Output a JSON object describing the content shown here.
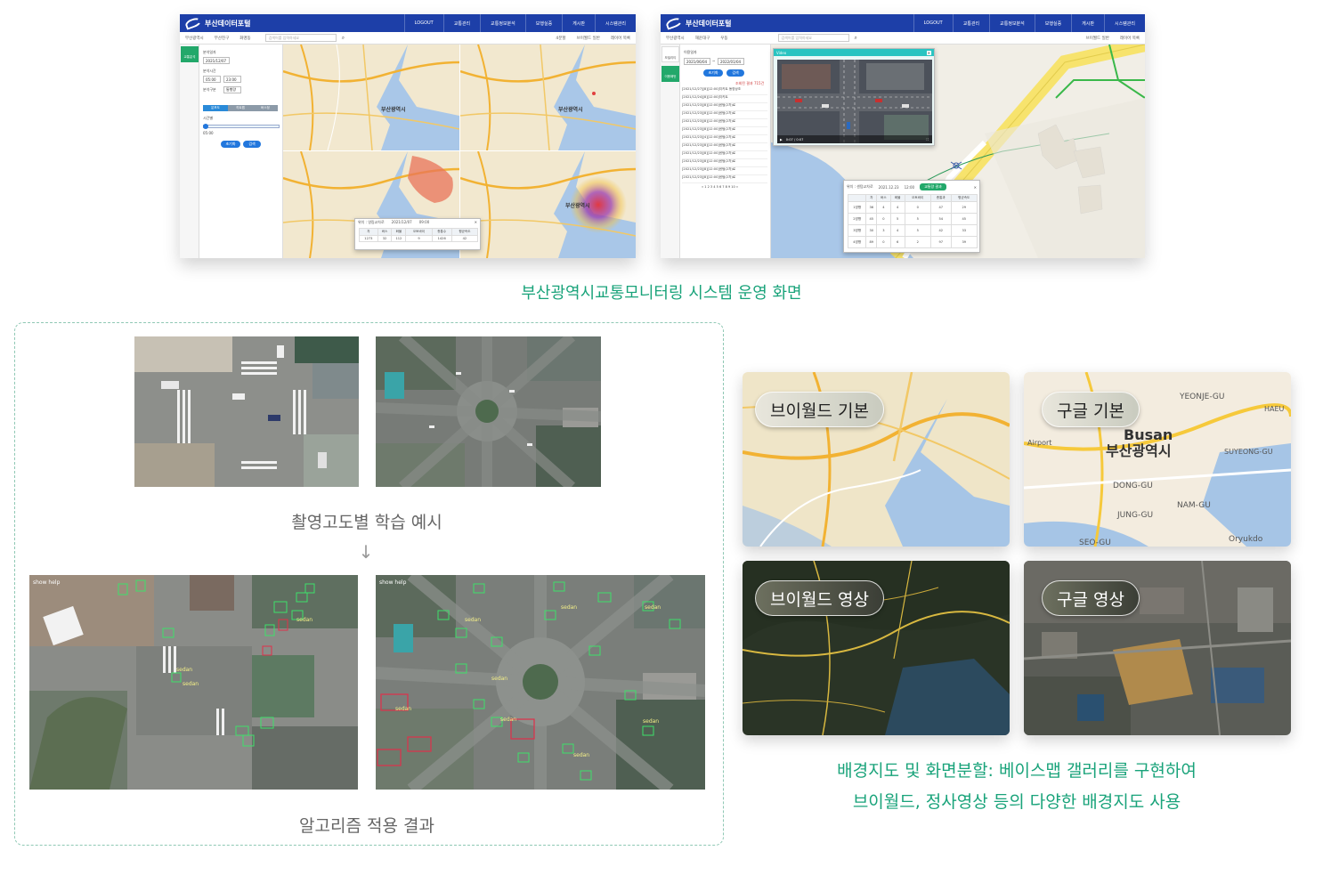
{
  "app": {
    "logo_text": "부산데이터포털",
    "menu": [
      "LOGOUT",
      "교통관리",
      "교통정보분석",
      "보행실증",
      "게시판",
      "시스템관리"
    ],
    "search_placeholder": "검색어를 입력하세요"
  },
  "shot1": {
    "breadcrumb": [
      "부산광역시",
      "부산진구",
      "화명동"
    ],
    "map_controls": [
      "4분할",
      "브이월드 일반",
      "레이어 목록"
    ],
    "rail": [
      "교통분석"
    ],
    "form": {
      "date_label": "분석일자",
      "date_value": "2021/12/07",
      "time_label": "분석시간",
      "time_from": "05:00",
      "time_to": "23:00",
      "type_label": "분석구분",
      "type_value": "통행량",
      "segments": [
        "분포도",
        "히트맵",
        "버스정"
      ],
      "slider_label": "시간별",
      "slider_value": "05:00",
      "reset_button": "초기화",
      "search_button": "검색"
    },
    "map_city_label": "부산광역시",
    "popup": {
      "title": "위치 : 영림교차로",
      "date": "2021/12/07",
      "time": "09:00",
      "headers": [
        "차",
        "버스",
        "화물",
        "오토바이",
        "총통수",
        "평균속도"
      ],
      "values": [
        "1273",
        "32",
        "112",
        "9",
        "1426",
        "42"
      ]
    }
  },
  "shot2": {
    "breadcrumb": [
      "부산광역시",
      "해운대구",
      "우동"
    ],
    "map_controls": [
      "브이월드 일반",
      "레이어 목록"
    ],
    "rail": [
      "모빌리티",
      "이용패턴"
    ],
    "form": {
      "date_label": "이용일자",
      "date_from": "2021/06/04",
      "date_to": "2022/01/04",
      "reset_button": "초기화",
      "search_button": "검색",
      "result_text": "조회된 결과 715건",
      "records": [
        "[2021/12/27][8][12:00]지키트 동영상조",
        "[2021/12/24][8][12:00]지키트",
        "[2021/12/23][8][12:00]센텀(2차)로",
        "[2021/12/23][8][12:00]센텀(2차)로",
        "[2021/12/23][8][12:00]센텀(2차)로",
        "[2021/12/23][8][12:00]센텀(2차)로",
        "[2021/12/23][4][12:00]센텀(2차)로",
        "[2021/12/23][8][12:00]센텀(2차)로",
        "[2021/12/23][8][12:00]센텀(2차)로",
        "[2021/12/23][8][12:00]센텀(2차)로",
        "[2021/12/23][8][12:00]센텀(2차)로",
        "[2021/12/23][8][12:00]센텀(2차)로"
      ],
      "pagination": "« 1 2 3 4 5 6 7 8 9 10 »"
    },
    "video": {
      "title": "Video",
      "time": "0:07 / 0:07"
    },
    "popup": {
      "title": "위치 : 센텀교차로",
      "date": "2021.12.23",
      "time": "12:00",
      "button": "교통량 결과",
      "headers": [
        "",
        "차",
        "버스",
        "화물",
        "오토바이",
        "총통과",
        "평균속도"
      ],
      "rows": [
        [
          "1방향",
          "36",
          "4",
          "4",
          "0",
          "47",
          "29"
        ],
        [
          "2방향",
          "45",
          "0",
          "5",
          "5",
          "54",
          "45"
        ],
        [
          "3방향",
          "30",
          "3",
          "4",
          "5",
          "42",
          "33"
        ],
        [
          "4방향",
          "89",
          "0",
          "6",
          "2",
          "97",
          "39"
        ]
      ]
    }
  },
  "captions": {
    "top": "부산광역시교통모니터링 시스템 운영 화면",
    "training": "촬영고도별 학습 예시",
    "arrow": "↓",
    "algorithm": "알고리즘 적용 결과",
    "gallery_line1": "배경지도 및 화면분할: 베이스맵 갤러리를 구현하여",
    "gallery_line2": "브이월드, 정사영상 등의 다양한 배경지도 사용"
  },
  "gallery": [
    {
      "label": "브이월드 기본"
    },
    {
      "label": "구글 기본"
    },
    {
      "label": "브이월드 영상"
    },
    {
      "label": "구글 영상"
    }
  ],
  "gallery_map_text": {
    "busan_en": "Busan",
    "busan_ko": "부산광역시",
    "yeonje": "YEONJE-GU",
    "dong": "DONG-GU",
    "jung": "JUNG-GU",
    "nam": "NAM-GU",
    "suyeong": "SUYEONG-GU",
    "haeun": "HAEU",
    "seo": "SEO-GU",
    "oryukdo": "Oryukdo",
    "airport": "Airport"
  },
  "detection": {
    "label": "sedan",
    "help": "show help"
  },
  "colors": {
    "accent_green": "#19a37a",
    "header_blue": "#1d3fa8",
    "button_blue": "#2277dd",
    "detect_green": "#3ee06a",
    "detect_red": "#e0304a"
  }
}
